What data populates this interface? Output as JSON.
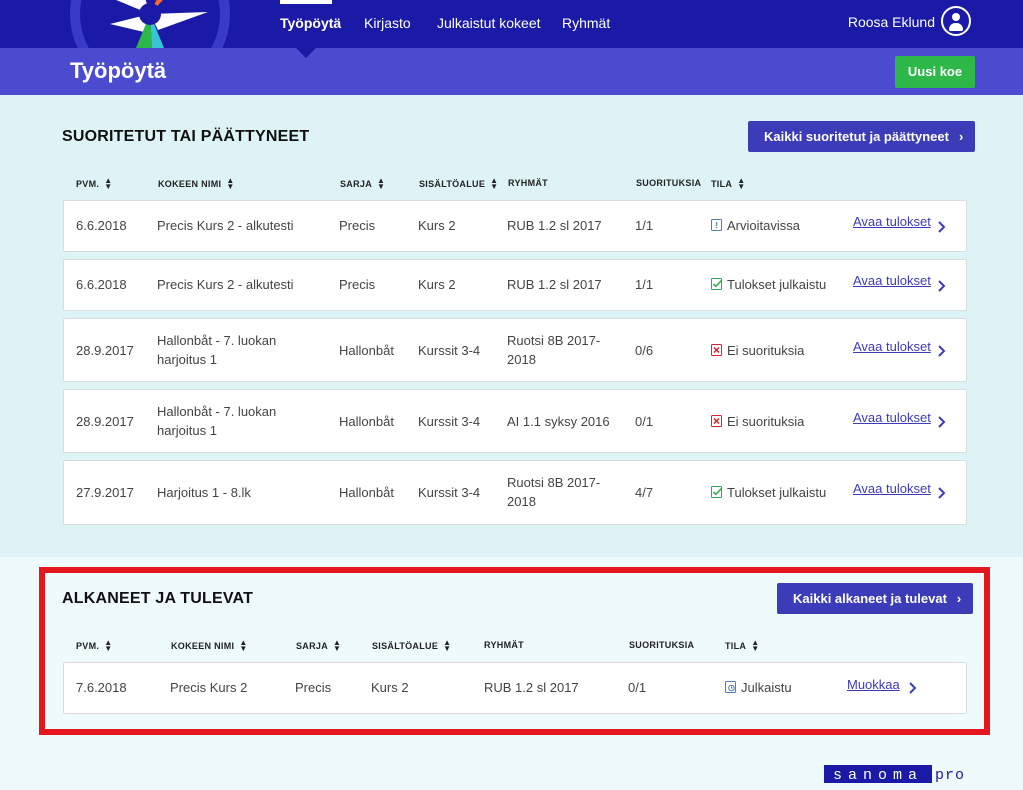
{
  "nav": {
    "items": [
      "Työpöytä",
      "Kirjasto",
      "Julkaistut kokeet",
      "Ryhmät"
    ],
    "user": "Roosa Eklund"
  },
  "header": {
    "title": "Työpöytä",
    "new_button": "Uusi koe"
  },
  "completed": {
    "title": "SUORITETUT TAI PÄÄTTYNEET",
    "all_button": "Kaikki suoritetut ja päättyneet",
    "columns": [
      "PVM.",
      "KOKEEN NIMI",
      "SARJA",
      "SISÄLTÖALUE",
      "RYHMÄT",
      "SUORITUKSIA",
      "TILA"
    ],
    "rows": [
      {
        "date": "6.6.2018",
        "name1": "Precis Kurs 2 - alkutesti",
        "name2": "",
        "series": "Precis",
        "area": "Kurs 2",
        "group1": "RUB 1.2 sl 2017",
        "group2": "",
        "count": "1/1",
        "status": "Arvioitavissa",
        "status_icon": "pending-icon",
        "link": "Avaa tulokset"
      },
      {
        "date": "6.6.2018",
        "name1": "Precis Kurs 2 - alkutesti",
        "name2": "",
        "series": "Precis",
        "area": "Kurs 2",
        "group1": "RUB 1.2 sl 2017",
        "group2": "",
        "count": "1/1",
        "status": "Tulokset julkaistu",
        "status_icon": "check-icon",
        "link": "Avaa tulokset"
      },
      {
        "date": "28.9.2017",
        "name1": "Hallonbåt - 7. luokan",
        "name2": "harjoitus 1",
        "series": "Hallonbåt",
        "area": "Kurssit 3-4",
        "group1": "Ruotsi 8B 2017-",
        "group2": "2018",
        "count": "0/6",
        "status": "Ei suorituksia",
        "status_icon": "x-icon",
        "link": "Avaa tulokset"
      },
      {
        "date": "28.9.2017",
        "name1": "Hallonbåt - 7. luokan",
        "name2": "harjoitus 1",
        "series": "Hallonbåt",
        "area": "Kurssit 3-4",
        "group1": "AI 1.1 syksy 2016",
        "group2": "",
        "count": "0/1",
        "status": "Ei suorituksia",
        "status_icon": "x-icon",
        "link": "Avaa tulokset"
      },
      {
        "date": "27.9.2017",
        "name1": "Harjoitus 1 - 8.lk",
        "name2": "",
        "series": "Hallonbåt",
        "area": "Kurssit 3-4",
        "group1": "Ruotsi 8B 2017-",
        "group2": "2018",
        "count": "4/7",
        "status": "Tulokset julkaistu",
        "status_icon": "check-icon",
        "link": "Avaa tulokset"
      }
    ]
  },
  "upcoming": {
    "title": "ALKANEET JA TULEVAT",
    "all_button": "Kaikki alkaneet ja tulevat",
    "columns": [
      "PVM.",
      "KOKEEN NIMI",
      "SARJA",
      "SISÄLTÖALUE",
      "RYHMÄT",
      "SUORITUKSIA",
      "TILA"
    ],
    "rows": [
      {
        "date": "7.6.2018",
        "name": "Precis Kurs 2",
        "series": "Precis",
        "area": "Kurs 2",
        "group": "RUB 1.2 sl 2017",
        "count": "0/1",
        "status": "Julkaistu",
        "status_icon": "clock-doc-icon",
        "link": "Muokkaa"
      }
    ]
  },
  "brand": {
    "left": "sanoma",
    "right": "pro"
  },
  "colors": {
    "nav_bg": "#1a1aa6",
    "title_bar": "#4b4bcf",
    "primary_button": "#3c3cb8",
    "new_button": "#2eb84a",
    "highlight": "#e4171f",
    "status_check": "#2aa84a",
    "status_x": "#e0202a",
    "status_pending": "#4a7fc0"
  }
}
